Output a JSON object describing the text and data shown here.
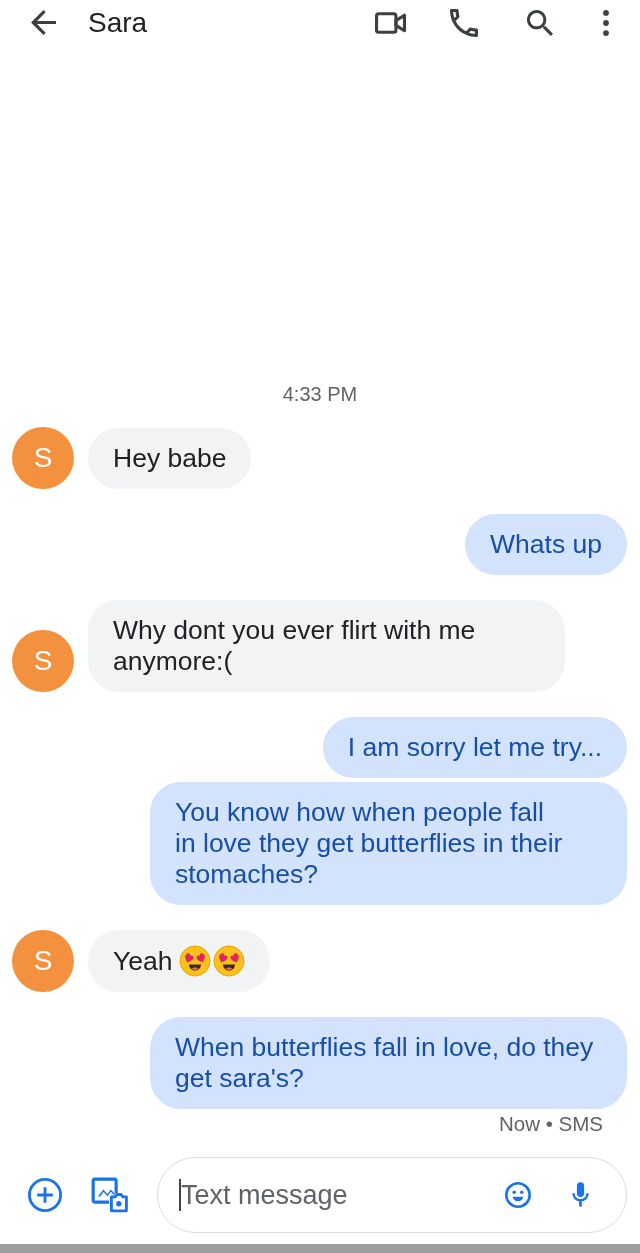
{
  "header": {
    "title": "Sara"
  },
  "conversation": {
    "timestamp": "4:33 PM",
    "messages": [
      {
        "kind": "incoming",
        "avatar_letter": "S",
        "text": "Hey babe"
      },
      {
        "kind": "outgoing",
        "text": "Whats up"
      },
      {
        "kind": "incoming",
        "avatar_letter": "S",
        "text": "Why dont you ever flirt with me anymore:("
      },
      {
        "kind": "outgoing",
        "text": "I am sorry let me try..."
      },
      {
        "kind": "outgoing",
        "text": "You know how when people fall\nin love they get butterflies in their stomaches?"
      },
      {
        "kind": "incoming",
        "avatar_letter": "S",
        "text": "Yeah",
        "emojis": [
          {
            "kind": "heart-eyes"
          },
          {
            "kind": "heart-eyes"
          }
        ]
      },
      {
        "kind": "outgoing",
        "text": "When butterflies fall in love, do they get sara's?"
      }
    ],
    "status": "Now • SMS"
  },
  "composer": {
    "placeholder": "Text message"
  }
}
